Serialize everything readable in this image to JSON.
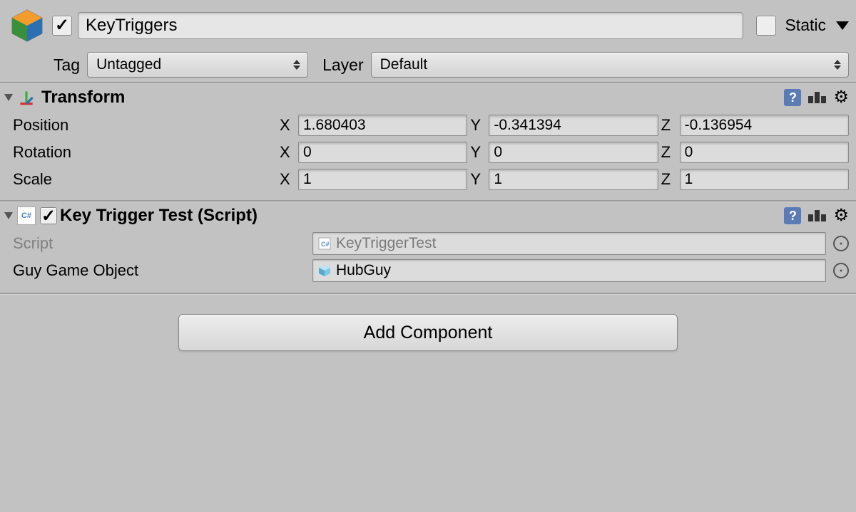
{
  "header": {
    "object_name": "KeyTriggers",
    "active": true,
    "static_label": "Static",
    "static_checked": false,
    "tag_label": "Tag",
    "tag_value": "Untagged",
    "layer_label": "Layer",
    "layer_value": "Default"
  },
  "transform": {
    "title": "Transform",
    "position_label": "Position",
    "rotation_label": "Rotation",
    "scale_label": "Scale",
    "axes": {
      "x": "X",
      "y": "Y",
      "z": "Z"
    },
    "position": {
      "x": "1.680403",
      "y": "-0.341394",
      "z": "-0.136954"
    },
    "rotation": {
      "x": "0",
      "y": "0",
      "z": "0"
    },
    "scale": {
      "x": "1",
      "y": "1",
      "z": "1"
    }
  },
  "script_component": {
    "title": "Key Trigger Test (Script)",
    "enabled": true,
    "script_label": "Script",
    "script_value": "KeyTriggerTest",
    "field_label": "Guy Game Object",
    "field_value": "HubGuy"
  },
  "add_component_label": "Add Component"
}
